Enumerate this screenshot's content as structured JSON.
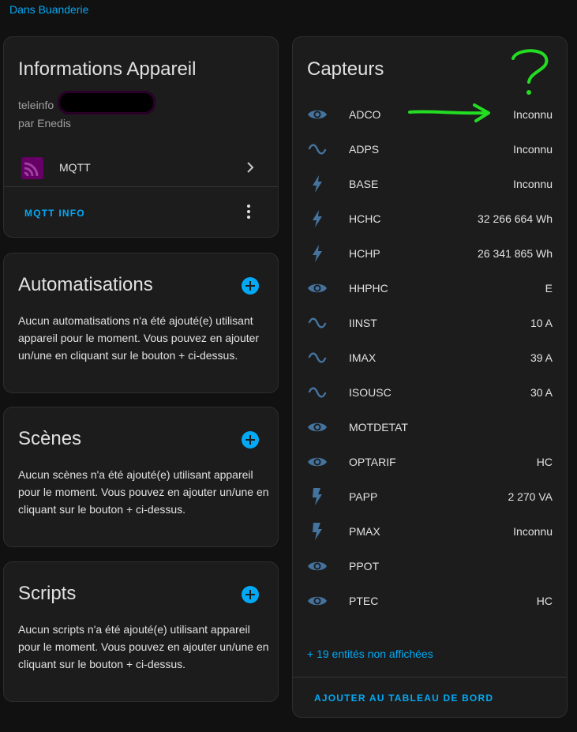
{
  "breadcrumb": {
    "area": "Dans Buanderie"
  },
  "device_info": {
    "title": "Informations Appareil",
    "model": "teleinfo",
    "manufacturer": "par Enedis",
    "integration": "MQTT",
    "action_button": "MQTT INFO"
  },
  "automations": {
    "title": "Automatisations",
    "text": "Aucun automatisations n'a été ajouté(e) utilisant appareil pour le moment. Vous pouvez en ajouter un/une en cliquant sur le bouton + ci-dessus."
  },
  "scenes": {
    "title": "Scènes",
    "text": "Aucun scènes n'a été ajouté(e) utilisant appareil pour le moment. Vous pouvez en ajouter un/une en cliquant sur le bouton + ci-dessus."
  },
  "scripts": {
    "title": "Scripts",
    "text": "Aucun scripts n'a été ajouté(e) utilisant appareil pour le moment. Vous pouvez en ajouter un/une en cliquant sur le bouton + ci-dessus."
  },
  "sensors": {
    "title": "Capteurs",
    "items": [
      {
        "name": "ADCO",
        "value": "Inconnu",
        "icon": "eye-icon"
      },
      {
        "name": "ADPS",
        "value": "Inconnu",
        "icon": "sine-wave-icon"
      },
      {
        "name": "BASE",
        "value": "Inconnu",
        "icon": "lightning-icon"
      },
      {
        "name": "HCHC",
        "value": "32 266 664 Wh",
        "icon": "lightning-icon"
      },
      {
        "name": "HCHP",
        "value": "26 341 865 Wh",
        "icon": "lightning-icon"
      },
      {
        "name": "HHPHC",
        "value": "E",
        "icon": "eye-icon"
      },
      {
        "name": "IINST",
        "value": "10 A",
        "icon": "sine-wave-icon"
      },
      {
        "name": "IMAX",
        "value": "39 A",
        "icon": "sine-wave-icon"
      },
      {
        "name": "ISOUSC",
        "value": "30 A",
        "icon": "sine-wave-icon"
      },
      {
        "name": "MOTDETAT",
        "value": "",
        "icon": "eye-icon"
      },
      {
        "name": "OPTARIF",
        "value": "HC",
        "icon": "eye-icon"
      },
      {
        "name": "PAPP",
        "value": "2 270 VA",
        "icon": "flash-icon"
      },
      {
        "name": "PMAX",
        "value": "Inconnu",
        "icon": "flash-icon"
      },
      {
        "name": "PPOT",
        "value": "",
        "icon": "eye-icon"
      },
      {
        "name": "PTEC",
        "value": "HC",
        "icon": "eye-icon"
      }
    ],
    "hidden_link": "+ 19 entités non affichées",
    "action_button": "AJOUTER AU TABLEAU DE BORD"
  },
  "colors": {
    "accent": "#03a9f4",
    "icon": "#44739e",
    "annotation": "#22dd22",
    "mqtt_brand": "#660066"
  }
}
